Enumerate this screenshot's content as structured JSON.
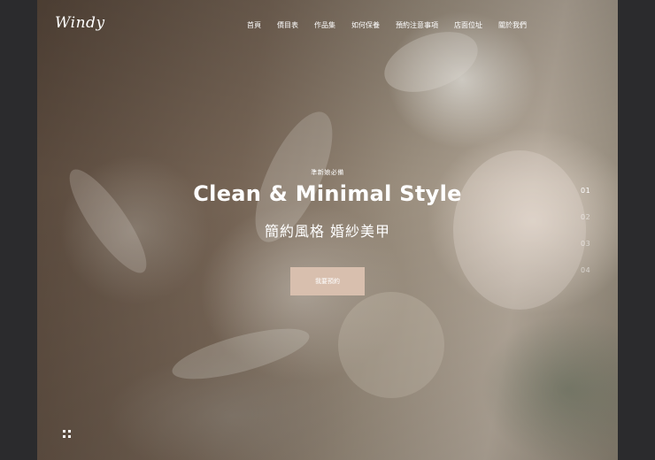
{
  "brand": {
    "logo": "Windy"
  },
  "nav": {
    "items": [
      {
        "label": "首頁"
      },
      {
        "label": "價目表"
      },
      {
        "label": "作品集"
      },
      {
        "label": "如何保養"
      },
      {
        "label": "預約注意事項"
      },
      {
        "label": "店面位址"
      },
      {
        "label": "關於我們"
      }
    ]
  },
  "hero": {
    "eyebrow": "準新娘必備",
    "title": "Clean & Minimal Style",
    "subtitle": "簡約風格 婚紗美甲",
    "cta_label": "我要預約"
  },
  "pager": {
    "slides": [
      "01",
      "02",
      "03",
      "04"
    ],
    "active": "01"
  },
  "colors": {
    "cta_background": "#d8bfae",
    "outer_background": "#2b2b2d",
    "text": "#ffffff"
  },
  "icons": {
    "menu": "grid-icon"
  }
}
